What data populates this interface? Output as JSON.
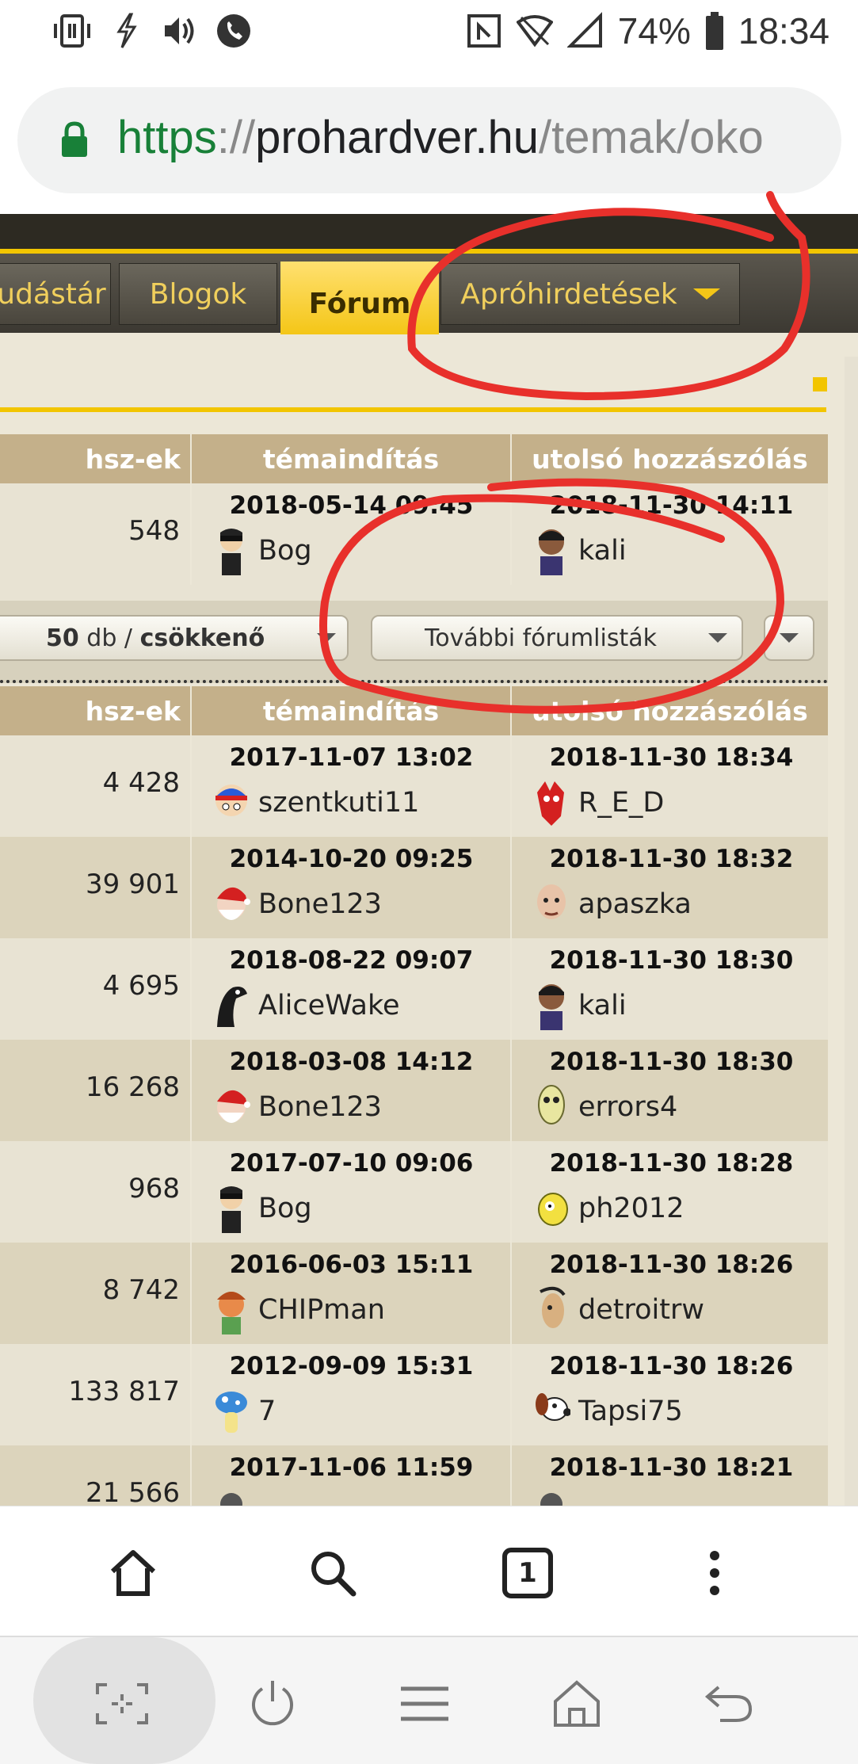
{
  "status_bar": {
    "icons": [
      "vibrate-icon",
      "flash-icon",
      "volume-icon",
      "call-icon",
      "nfc-icon",
      "wifi-icon",
      "signal-icon",
      "battery-icon"
    ],
    "battery": "74%",
    "time": "18:34"
  },
  "browser": {
    "url": {
      "scheme": "https",
      "sep": "://",
      "host": "prohardver.hu",
      "path": "/temak/oko"
    },
    "bottom_tabs_count": "1"
  },
  "site": {
    "accent": "#f2c500",
    "nav": {
      "tabs": [
        {
          "label": "udástár"
        },
        {
          "label": "Blogok"
        },
        {
          "label": "Fórum"
        },
        {
          "label": "Apróhirdetések"
        }
      ]
    },
    "table_header": {
      "count": "hsz-ek",
      "start": "témaindítás",
      "last": "utolsó hozzászólás"
    },
    "pinned_rows": [
      {
        "count": "548",
        "start_date": "2018-05-14 09:45",
        "start_user": "Bog",
        "last_date": "2018-11-30 14:11",
        "last_user": "kali"
      }
    ],
    "controls": {
      "sort_prefix": "50",
      "sort_unit": " db / ",
      "sort_order": "csökkenő",
      "more_lists": "További fórumlisták"
    },
    "rows": [
      {
        "count": "4 428",
        "start_date": "2017-11-07 13:02",
        "start_user": "szentkuti11",
        "last_date": "2018-11-30 18:34",
        "last_user": "R_E_D"
      },
      {
        "count": "39 901",
        "start_date": "2014-10-20 09:25",
        "start_user": "Bone123",
        "last_date": "2018-11-30 18:32",
        "last_user": "apaszka"
      },
      {
        "count": "4 695",
        "start_date": "2018-08-22 09:07",
        "start_user": "AliceWake",
        "last_date": "2018-11-30 18:30",
        "last_user": "kali"
      },
      {
        "count": "16 268",
        "start_date": "2018-03-08 14:12",
        "start_user": "Bone123",
        "last_date": "2018-11-30 18:30",
        "last_user": "errors4"
      },
      {
        "count": "968",
        "start_date": "2017-07-10 09:06",
        "start_user": "Bog",
        "last_date": "2018-11-30 18:28",
        "last_user": "ph2012"
      },
      {
        "count": "8 742",
        "start_date": "2016-06-03 15:11",
        "start_user": "CHIPman",
        "last_date": "2018-11-30 18:26",
        "last_user": "detroitrw"
      },
      {
        "count": "133 817",
        "start_date": "2012-09-09 15:31",
        "start_user": "7",
        "last_date": "2018-11-30 18:26",
        "last_user": "Tapsi75"
      },
      {
        "count": "21 566",
        "start_date": "2017-11-06 11:59",
        "start_user": "",
        "last_date": "2018-11-30 18:21",
        "last_user": ""
      }
    ]
  }
}
